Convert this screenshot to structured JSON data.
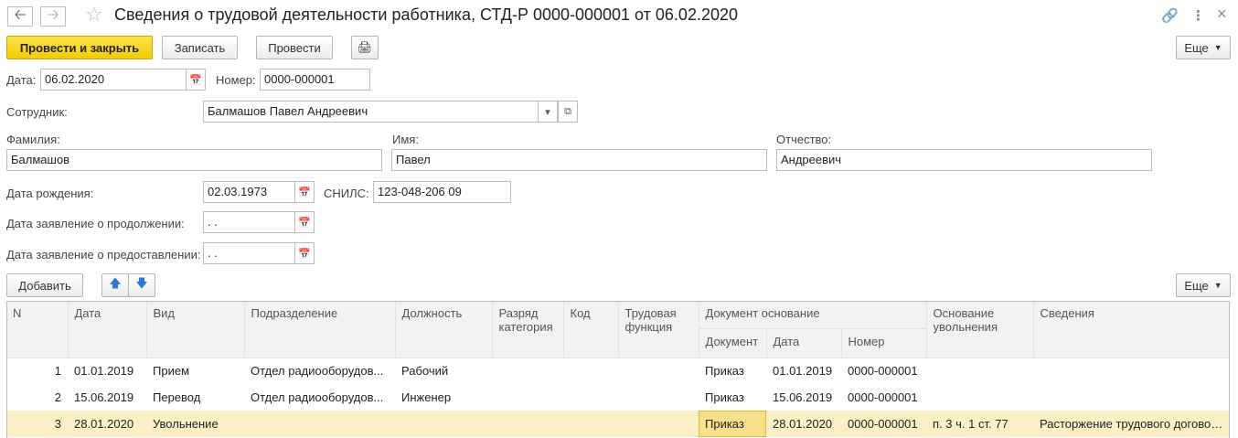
{
  "window": {
    "title": "Сведения о трудовой деятельности работника, СТД-Р 0000-000001 от 06.02.2020",
    "back_icon": "arrow-left-icon",
    "forward_icon": "arrow-right-icon"
  },
  "toolbar": {
    "post_close": "Провести и закрыть",
    "save": "Записать",
    "post": "Провести",
    "more": "Еще"
  },
  "form": {
    "date_label": "Дата:",
    "date_value": "06.02.2020",
    "number_label": "Номер:",
    "number_value": "0000-000001",
    "employee_label": "Сотрудник:",
    "employee_value": "Балмашов Павел Андреевич",
    "lastname_label": "Фамилия:",
    "lastname_value": "Балмашов",
    "firstname_label": "Имя:",
    "firstname_value": "Павел",
    "patronymic_label": "Отчество:",
    "patronymic_value": "Андреевич",
    "birthdate_label": "Дата рождения:",
    "birthdate_value": "02.03.1973",
    "snils_label": "СНИЛС:",
    "snils_value": "123-048-206 09",
    "continue_label": "Дата заявление о продолжении:",
    "continue_value": " .  .",
    "provide_label": "Дата заявление о предоставлении:",
    "provide_value": " .  ."
  },
  "table_toolbar": {
    "add": "Добавить",
    "more": "Еще"
  },
  "table": {
    "headers": {
      "n": "N",
      "date": "Дата",
      "kind": "Вид",
      "dept": "Подразделение",
      "position": "Должность",
      "rank": "Разряд категория",
      "code": "Код",
      "labor_function": "Трудовая функция",
      "basis_doc": "Документ основание",
      "doc": "Документ",
      "doc_date": "Дата",
      "doc_number": "Номер",
      "dismissal_basis": "Основание увольнения",
      "info": "Сведения"
    },
    "rows": [
      {
        "n": "1",
        "date": "01.01.2019",
        "kind": "Прием",
        "dept": "Отдел радиооборудов...",
        "position": "Рабочий",
        "rank": "",
        "code": "",
        "labor_function": "",
        "doc": "Приказ",
        "doc_date": "01.01.2019",
        "doc_number": "0000-000001",
        "dismissal_basis": "",
        "info": ""
      },
      {
        "n": "2",
        "date": "15.06.2019",
        "kind": "Перевод",
        "dept": "Отдел радиооборудов...",
        "position": "Инженер",
        "rank": "",
        "code": "",
        "labor_function": "",
        "doc": "Приказ",
        "doc_date": "15.06.2019",
        "doc_number": "0000-000001",
        "dismissal_basis": "",
        "info": ""
      },
      {
        "n": "3",
        "date": "28.01.2020",
        "kind": "Увольнение",
        "dept": "",
        "position": "",
        "rank": "",
        "code": "",
        "labor_function": "",
        "doc": "Приказ",
        "doc_date": "28.01.2020",
        "doc_number": "0000-000001",
        "dismissal_basis": "п. 3 ч. 1 ст. 77",
        "info": "Расторжение трудового договора"
      }
    ]
  }
}
